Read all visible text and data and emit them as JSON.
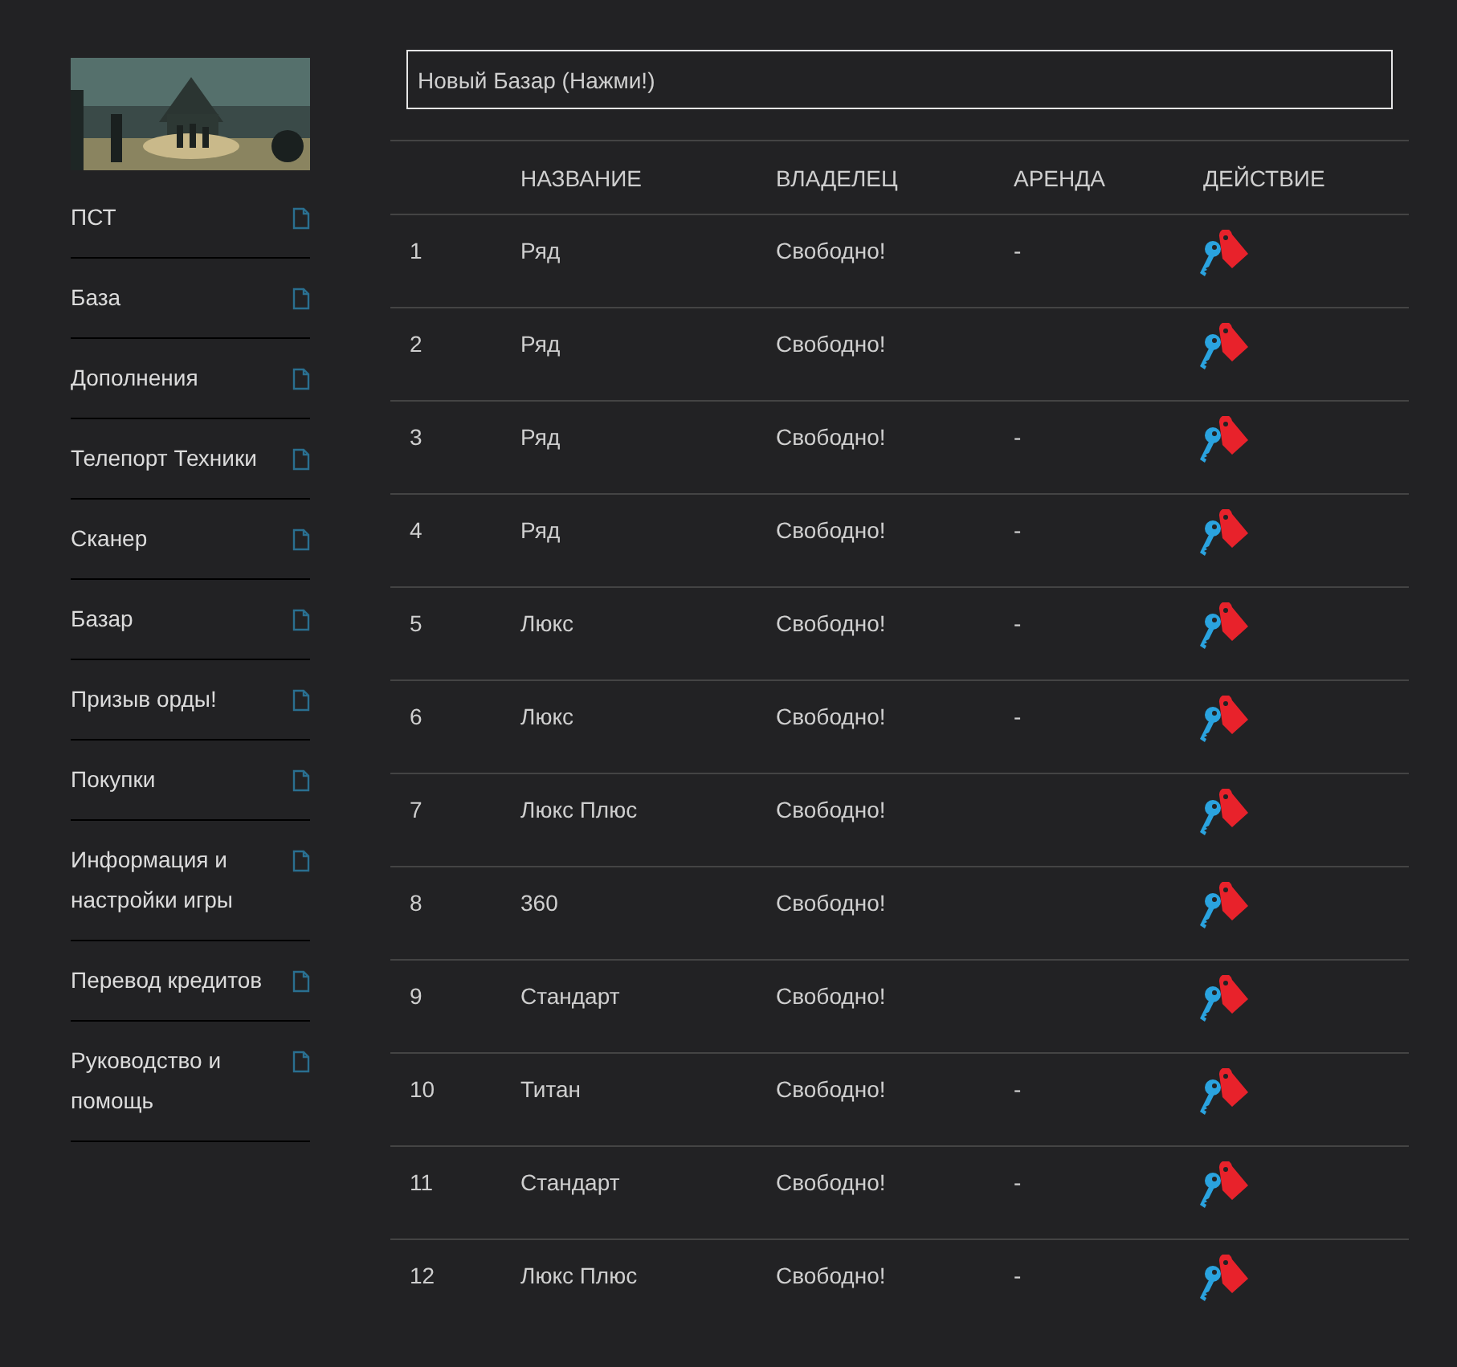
{
  "sidebar": {
    "items": [
      {
        "label": "ПСТ"
      },
      {
        "label": "База"
      },
      {
        "label": "Дополнения"
      },
      {
        "label": "Телепорт Техники"
      },
      {
        "label": "Сканер"
      },
      {
        "label": "Базар"
      },
      {
        "label": "Призыв орды!"
      },
      {
        "label": "Покупки"
      },
      {
        "label": "Информация и настройки игры"
      },
      {
        "label": "Перевод кредитов"
      },
      {
        "label": "Руководство и помощь"
      }
    ]
  },
  "new_bazaar_button": "Новый Базар (Нажми!)",
  "table": {
    "columns": [
      "НАЗВАНИЕ",
      "ВЛАДЕЛЕЦ",
      "АРЕНДА",
      "ДЕЙСТВИЕ"
    ],
    "rows": [
      {
        "number": "1",
        "name": "Ряд",
        "owner": "Свободно!",
        "rent": "-"
      },
      {
        "number": "2",
        "name": "Ряд",
        "owner": "Свободно!"
      },
      {
        "number": "3",
        "name": "Ряд",
        "owner": "Свободно!",
        "rent": "-"
      },
      {
        "number": "4",
        "name": "Ряд",
        "owner": "Свободно!",
        "rent": "-"
      },
      {
        "number": "5",
        "name": "Люкс",
        "owner": "Свободно!",
        "rent": "-"
      },
      {
        "number": "6",
        "name": "Люкс",
        "owner": "Свободно!",
        "rent": "-"
      },
      {
        "number": "7",
        "name": "Люкс Плюс",
        "owner": "Свободно!"
      },
      {
        "number": "8",
        "name": "360",
        "owner": "Свободно!"
      },
      {
        "number": "9",
        "name": "Стандарт",
        "owner": "Свободно!"
      },
      {
        "number": "10",
        "name": "Титан",
        "owner": "Свободно!",
        "rent": "-"
      },
      {
        "number": "11",
        "name": "Стандарт",
        "owner": "Свободно!",
        "rent": "-"
      },
      {
        "number": "12",
        "name": "Люкс Плюс",
        "owner": "Свободно!",
        "rent": "-"
      }
    ]
  }
}
